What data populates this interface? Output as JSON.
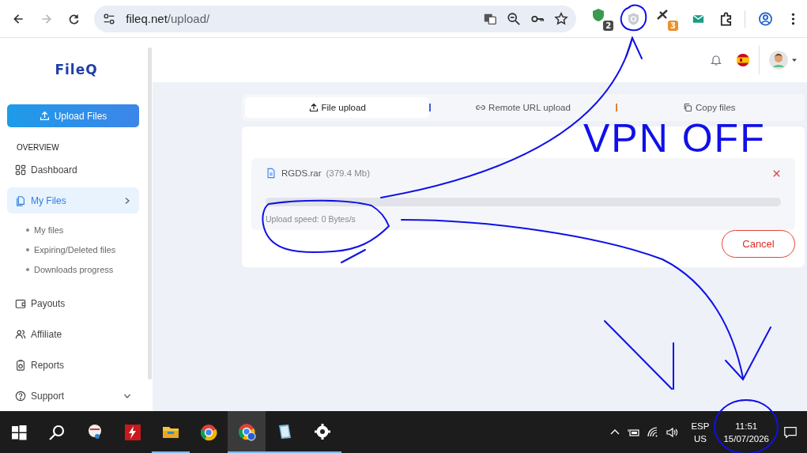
{
  "browser": {
    "url": {
      "host": "fileq.net",
      "path": "/upload/"
    },
    "back_disabled": false,
    "forward_disabled": true,
    "extensions": [
      {
        "badge": "2",
        "color": "#4a4a4a"
      },
      {
        "badge": "3",
        "color": "#e8912d"
      }
    ]
  },
  "sidebar": {
    "logo": "FileQ",
    "upload_button": "Upload Files",
    "section": "OVERVIEW",
    "items": [
      {
        "label": "Dashboard",
        "selected": false
      },
      {
        "label": "My Files",
        "selected": true,
        "expanded": true,
        "children": [
          {
            "label": "My files"
          },
          {
            "label": "Expiring/Deleted files"
          },
          {
            "label": "Downloads progress"
          }
        ]
      },
      {
        "label": "Payouts",
        "selected": false
      },
      {
        "label": "Affiliate",
        "selected": false
      },
      {
        "label": "Reports",
        "selected": false
      },
      {
        "label": "Support",
        "selected": false,
        "expanded": false
      }
    ]
  },
  "tabs": [
    {
      "label": "File upload",
      "selected": true
    },
    {
      "label": "Remote URL upload",
      "selected": false
    },
    {
      "label": "Copy files",
      "selected": false
    }
  ],
  "upload": {
    "file_name": "RGDS.rar",
    "size": "(379.4 Mb)",
    "level": 0,
    "speed": "Upload speed: 0 Bytes/s",
    "cancel": "Cancel"
  },
  "annotation": {
    "note": "VPN OFF"
  },
  "taskbar": {
    "apps": [
      {
        "running": false,
        "selected": false
      },
      {
        "running": false,
        "selected": false
      },
      {
        "running": false,
        "selected": false
      },
      {
        "running": false,
        "selected": false
      },
      {
        "running": true,
        "selected": false
      },
      {
        "running": false,
        "selected": false
      },
      {
        "running": true,
        "selected": true
      },
      {
        "running": true,
        "selected": false
      },
      {
        "running": true,
        "selected": false
      }
    ],
    "language": "ESP",
    "layout": "US",
    "time": "11:51",
    "date": "15/07/2026"
  }
}
